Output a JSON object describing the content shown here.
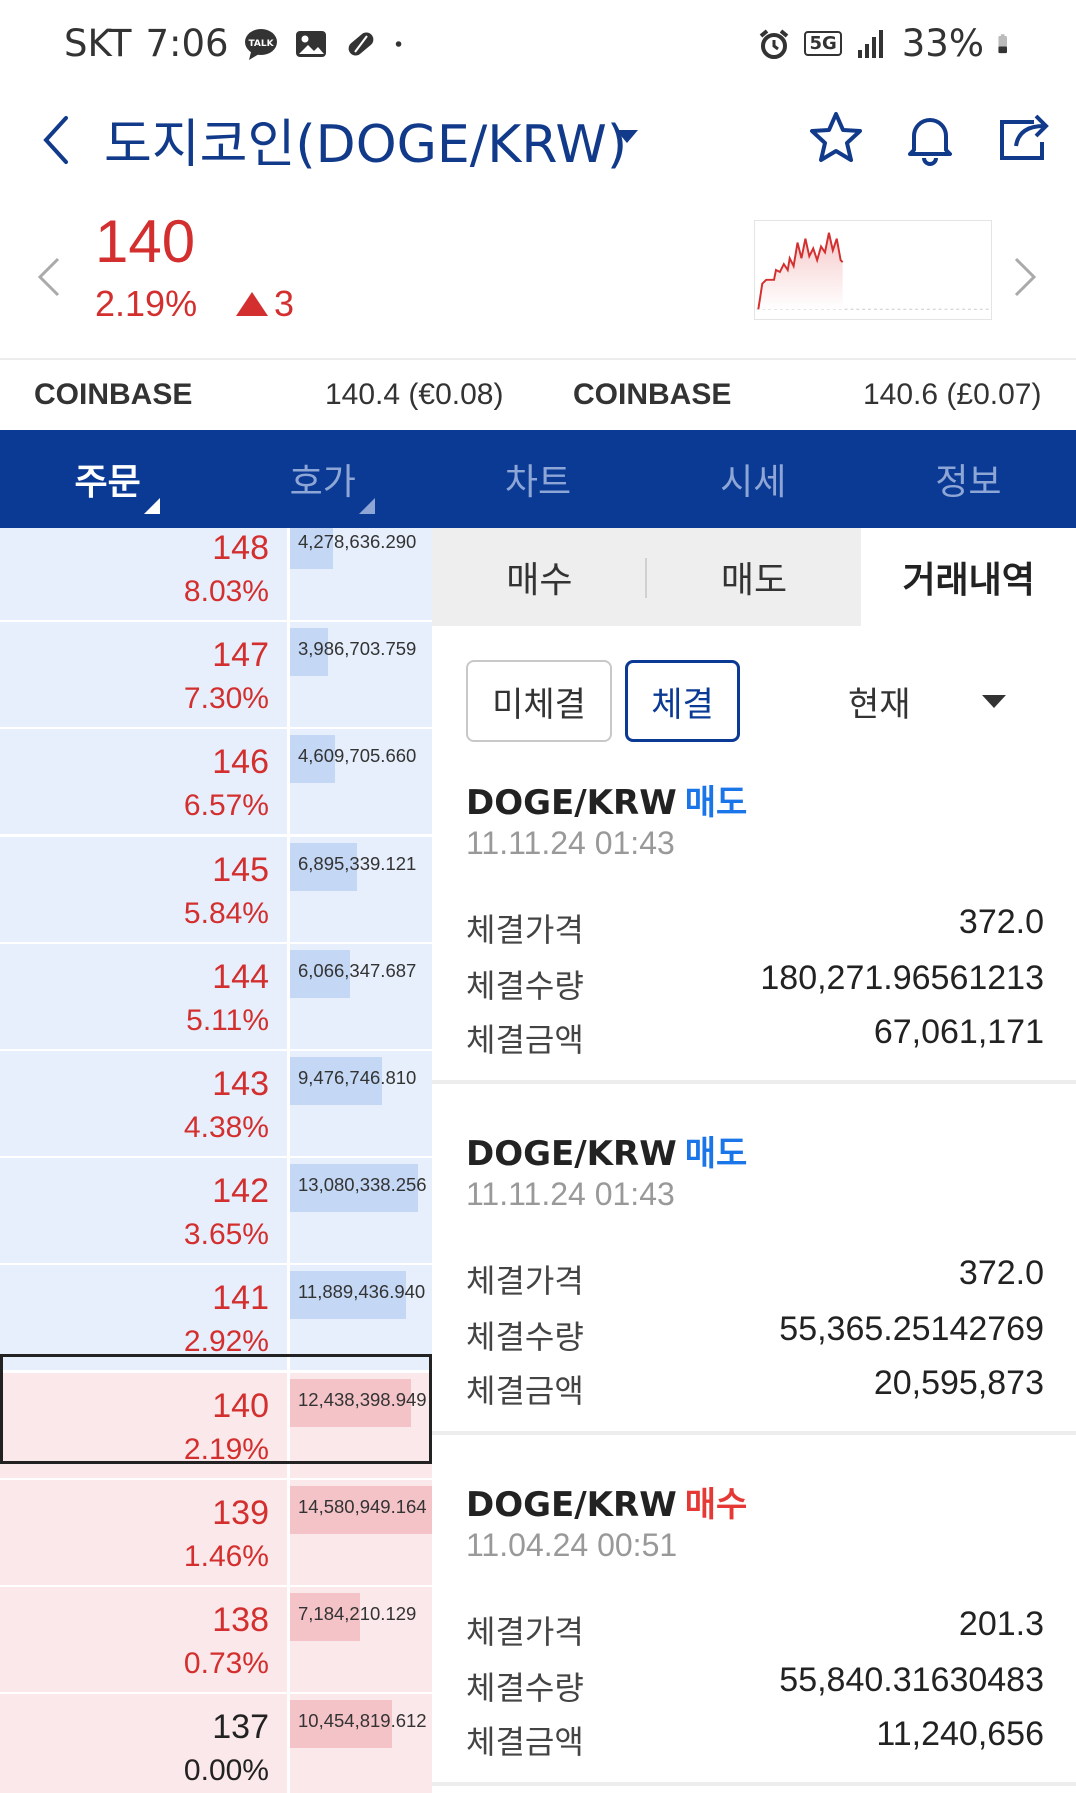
{
  "status_bar": {
    "carrier": "SKT",
    "time": "7:06",
    "network": "5G",
    "battery": "33%"
  },
  "header": {
    "title": "도지코인(DOGE/KRW)"
  },
  "price": {
    "current": "140",
    "change_pct": "2.19%",
    "change_abs": "3",
    "color": "#d32f2f"
  },
  "exchanges": [
    {
      "name": "COINBASE",
      "value": "140.4 (€0.08)"
    },
    {
      "name": "COINBASE",
      "value": "140.6 (£0.07)"
    }
  ],
  "tabs": [
    {
      "label": "주문"
    },
    {
      "label": "호가"
    },
    {
      "label": "차트"
    },
    {
      "label": "시세"
    },
    {
      "label": "정보"
    }
  ],
  "order_book": [
    {
      "price": "148",
      "rate": "8.03%",
      "volume": "4,278,636.290",
      "side": "ask",
      "fill": 0.3
    },
    {
      "price": "147",
      "rate": "7.30%",
      "volume": "3,986,703.759",
      "side": "ask",
      "fill": 0.27
    },
    {
      "price": "146",
      "rate": "6.57%",
      "volume": "4,609,705.660",
      "side": "ask",
      "fill": 0.32
    },
    {
      "price": "145",
      "rate": "5.84%",
      "volume": "6,895,339.121",
      "side": "ask",
      "fill": 0.47
    },
    {
      "price": "144",
      "rate": "5.11%",
      "volume": "6,066,347.687",
      "side": "ask",
      "fill": 0.42
    },
    {
      "price": "143",
      "rate": "4.38%",
      "volume": "9,476,746.810",
      "side": "ask",
      "fill": 0.65
    },
    {
      "price": "142",
      "rate": "3.65%",
      "volume": "13,080,338.256",
      "side": "ask",
      "fill": 0.9
    },
    {
      "price": "141",
      "rate": "2.92%",
      "volume": "11,889,436.940",
      "side": "ask",
      "fill": 0.82
    },
    {
      "price": "140",
      "rate": "2.19%",
      "volume": "12,438,398.949",
      "side": "bid",
      "fill": 0.85
    },
    {
      "price": "139",
      "rate": "1.46%",
      "volume": "14,580,949.164",
      "side": "bid",
      "fill": 1.0
    },
    {
      "price": "138",
      "rate": "0.73%",
      "volume": "7,184,210.129",
      "side": "bid",
      "fill": 0.49
    },
    {
      "price": "137",
      "rate": "0.00%",
      "volume": "10,454,819.612",
      "side": "bid",
      "fill": 0.72
    }
  ],
  "order_book_colors": {
    "up": "#d32f2f",
    "flat": "#222222"
  },
  "sub_tabs": [
    {
      "label": "매수"
    },
    {
      "label": "매도"
    },
    {
      "label": "거래내역"
    }
  ],
  "filters": {
    "unfilled": "미체결",
    "filled": "체결",
    "period": "현재"
  },
  "trades": [
    {
      "pair": "DOGE/KRW",
      "side": "매도",
      "side_type": "sell",
      "date": "11.11.24 01:43",
      "rows": [
        {
          "label": "체결가격",
          "value": "372.0"
        },
        {
          "label": "체결수량",
          "value": "180,271.96561213"
        },
        {
          "label": "체결금액",
          "value": "67,061,171"
        }
      ]
    },
    {
      "pair": "DOGE/KRW",
      "side": "매도",
      "side_type": "sell",
      "date": "11.11.24 01:43",
      "rows": [
        {
          "label": "체결가격",
          "value": "372.0"
        },
        {
          "label": "체결수량",
          "value": "55,365.25142769"
        },
        {
          "label": "체결금액",
          "value": "20,595,873"
        }
      ]
    },
    {
      "pair": "DOGE/KRW",
      "side": "매수",
      "side_type": "buy",
      "date": "11.04.24 00:51",
      "rows": [
        {
          "label": "체결가격",
          "value": "201.3"
        },
        {
          "label": "체결수량",
          "value": "55,840.31630483"
        },
        {
          "label": "체결금액",
          "value": "11,240,656"
        }
      ]
    }
  ],
  "icons": {
    "back": "back-arrow-icon",
    "dropdown": "caret-down-icon",
    "favorite": "star-icon",
    "alert": "bell-icon",
    "share": "share-icon"
  }
}
